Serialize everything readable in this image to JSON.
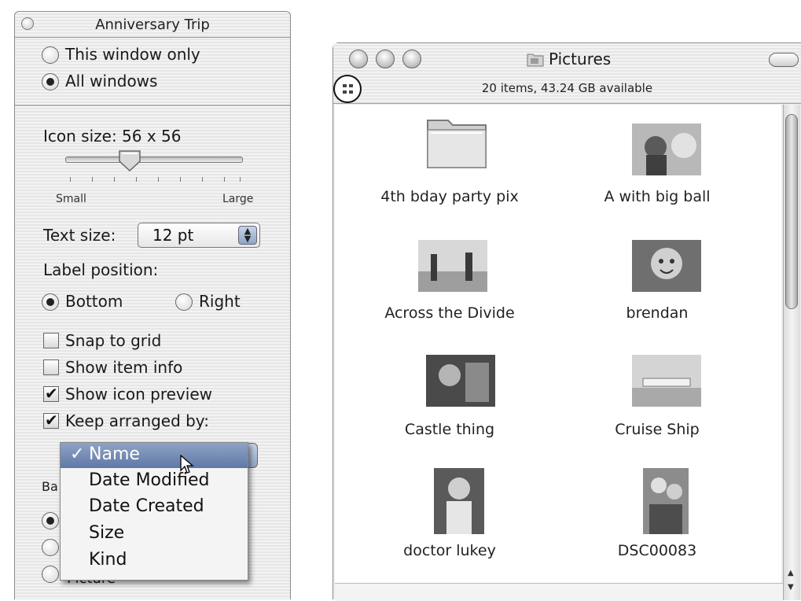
{
  "view_options": {
    "title": "Anniversary Trip",
    "scope": {
      "this_window": "This window only",
      "all_windows": "All windows",
      "selected": "All windows"
    },
    "icon_size": {
      "label": "Icon size: 56 x 56",
      "small": "Small",
      "large": "Large"
    },
    "text_size": {
      "label": "Text size:",
      "value": "12 pt"
    },
    "label_position": {
      "label": "Label position:",
      "bottom": "Bottom",
      "right": "Right",
      "selected": "Bottom"
    },
    "checkboxes": [
      {
        "label": "Snap to grid",
        "checked": false
      },
      {
        "label": "Show item info",
        "checked": false
      },
      {
        "label": "Show icon preview",
        "checked": true
      },
      {
        "label": "Keep arranged by:",
        "checked": true
      }
    ],
    "background_partial": "Ba",
    "background_picture_partial": "Picture",
    "arrange_menu": {
      "selected": "Name",
      "items": [
        "Name",
        "Date Modified",
        "Date Created",
        "Size",
        "Kind"
      ]
    }
  },
  "finder": {
    "title": "Pictures",
    "status": "20 items, 43.24 GB available",
    "items": [
      {
        "name": "4th bday party pix",
        "kind": "folder"
      },
      {
        "name": "A with big ball",
        "kind": "photo"
      },
      {
        "name": "Across the Divide",
        "kind": "photo"
      },
      {
        "name": "brendan",
        "kind": "photo"
      },
      {
        "name": "Castle thing",
        "kind": "photo"
      },
      {
        "name": "Cruise Ship",
        "kind": "photo"
      },
      {
        "name": "doctor lukey",
        "kind": "photo"
      },
      {
        "name": "DSC00083",
        "kind": "photo"
      }
    ]
  }
}
